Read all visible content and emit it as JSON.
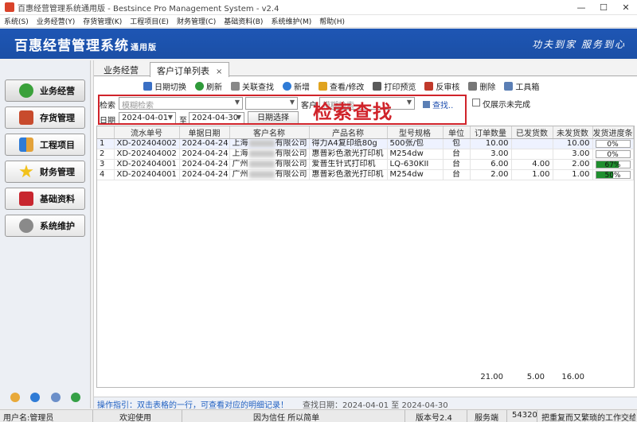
{
  "window": {
    "title": "百惠经营管理系统通用版 - Bestsince Pro Management System - v2.4",
    "controls": [
      "—",
      "☐",
      "✕"
    ]
  },
  "menu": [
    "系统(S)",
    "业务经营(Y)",
    "存货管理(K)",
    "工程项目(E)",
    "财务管理(C)",
    "基础资料(B)",
    "系统维护(M)",
    "帮助(H)"
  ],
  "banner": {
    "name": "百惠经营管理系统",
    "edition": "通用版",
    "slogan": "功夫到家 服务到心"
  },
  "sidebar": {
    "items": [
      {
        "label": "业务经营",
        "icon": "check-icon"
      },
      {
        "label": "存货管理",
        "icon": "house-icon"
      },
      {
        "label": "工程项目",
        "icon": "project-icon"
      },
      {
        "label": "财务管理",
        "icon": "star-icon"
      },
      {
        "label": "基础资料",
        "icon": "book-icon"
      },
      {
        "label": "系统维护",
        "icon": "gear-icon"
      }
    ]
  },
  "tabs": [
    {
      "label": "业务经营"
    },
    {
      "label": "客户订单列表",
      "close": "×"
    }
  ],
  "toolbar": [
    {
      "label": "日期切换",
      "icon": "calendar-icon",
      "color": "#3a6fc4"
    },
    {
      "label": "刷新",
      "icon": "refresh-icon",
      "color": "#2f9a3a"
    },
    {
      "label": "关联查找",
      "icon": "link-search-icon",
      "color": "#888888"
    },
    {
      "label": "新增",
      "icon": "add-icon",
      "color": "#2f7bd6"
    },
    {
      "label": "查看/修改",
      "icon": "edit-icon",
      "color": "#e0a31f"
    },
    {
      "label": "打印预览",
      "icon": "print-icon",
      "color": "#5a5a5a"
    },
    {
      "label": "反审核",
      "icon": "unaudit-icon",
      "color": "#c0392b"
    },
    {
      "label": "删除",
      "icon": "delete-icon",
      "color": "#777777"
    },
    {
      "label": "工具箱",
      "icon": "toolbox-icon",
      "color": "#5b7fb5"
    }
  ],
  "filter": {
    "search_label": "检索",
    "search_placeholder": "模糊检索",
    "customer_label": "客户",
    "customer_placeholder": "模糊检索",
    "find_label": "查找..",
    "only_unfinished_label": "仅展示未完成",
    "date_label": "日期",
    "date_from": "2024-04-01",
    "date_sep": "至",
    "date_to": "2024-04-30",
    "date_select_label": "日期选择",
    "overlay_annotation": "检索查找"
  },
  "table": {
    "columns": [
      "",
      "流水单号",
      "单据日期",
      "客户名称",
      "产品名称",
      "型号规格",
      "单位",
      "订单数量",
      "已发货数",
      "未发货数",
      "发货进度条"
    ],
    "rows": [
      {
        "idx": "1",
        "no": "XD-202404002",
        "date": "2024-04-24",
        "cust_pre": "上海",
        "cust_suf": "有限公司",
        "product": "得力A4复印纸80g",
        "spec": "500张/包",
        "unit": "包",
        "qty": "10.00",
        "shipped": "",
        "unshipped": "10.00",
        "progress": 0,
        "progress_text": "0%"
      },
      {
        "idx": "2",
        "no": "XD-202404002",
        "date": "2024-04-24",
        "cust_pre": "上海",
        "cust_suf": "有限公司",
        "product": "惠普彩色激光打印机",
        "spec": "M254dw",
        "unit": "台",
        "qty": "3.00",
        "shipped": "",
        "unshipped": "3.00",
        "progress": 0,
        "progress_text": "0%"
      },
      {
        "idx": "3",
        "no": "XD-202404001",
        "date": "2024-04-24",
        "cust_pre": "广州",
        "cust_suf": "有限公司",
        "product": "爱普生针式打印机",
        "spec": "LQ-630KII",
        "unit": "台",
        "qty": "6.00",
        "shipped": "4.00",
        "unshipped": "2.00",
        "progress": 67,
        "progress_text": "67%"
      },
      {
        "idx": "4",
        "no": "XD-202404001",
        "date": "2024-04-24",
        "cust_pre": "广州",
        "cust_suf": "有限公司",
        "product": "惠普彩色激光打印机",
        "spec": "M254dw",
        "unit": "台",
        "qty": "2.00",
        "shipped": "1.00",
        "unshipped": "1.00",
        "progress": 50,
        "progress_text": "50%"
      }
    ],
    "totals": {
      "qty": "21.00",
      "shipped": "5.00",
      "unshipped": "16.00"
    }
  },
  "guide": {
    "hint": "操作指引：双击表格的一行，可查看对应的明细记录！",
    "range": "查找日期：2024-04-01 至 2024-04-30"
  },
  "status": {
    "user": "用户名:管理员",
    "welcome": "欢迎使用",
    "motto": "因为信任 所以简单",
    "version": "版本号2.4",
    "server_label": "服务端",
    "server_port": "54320",
    "tip": "把重复而又繁琐的工作交给"
  },
  "colors": {
    "banner": "#1e56b4",
    "highlight": "#d0232a",
    "progress": "#1f8f2f"
  }
}
